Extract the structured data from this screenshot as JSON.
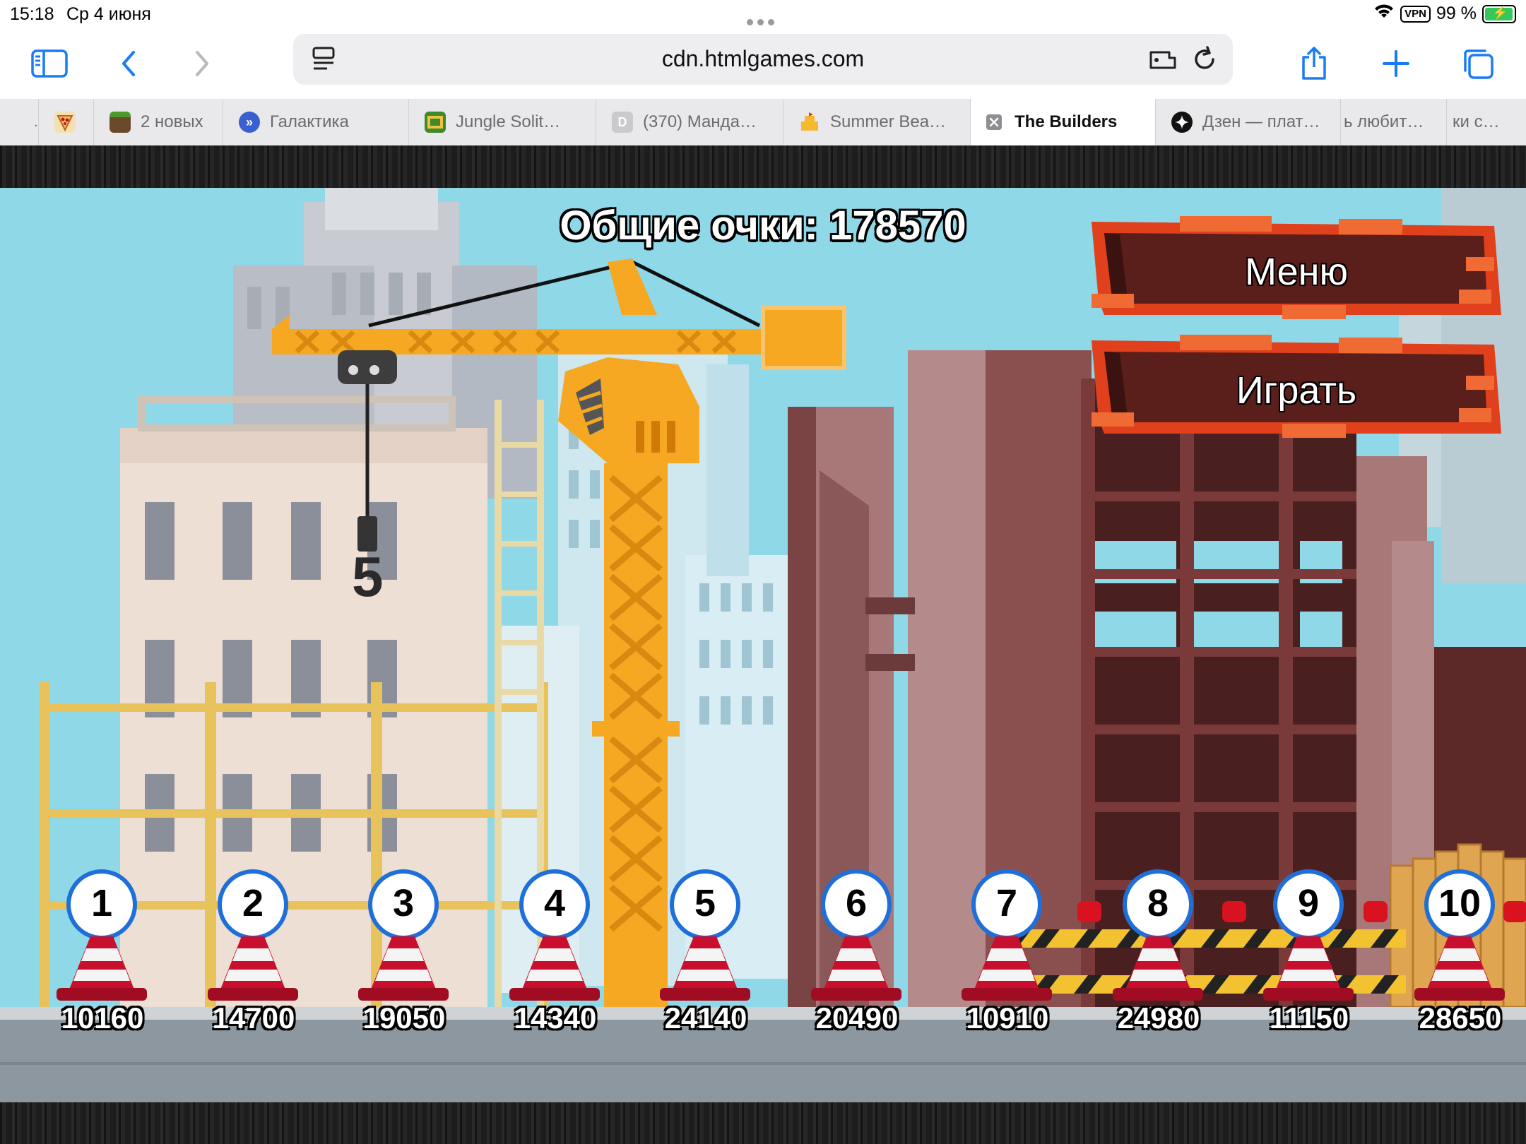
{
  "status": {
    "time": "15:18",
    "date": "Ср 4 июня",
    "vpn": "VPN",
    "battery": "99 %"
  },
  "browser": {
    "url": "cdn.htmlgames.com"
  },
  "tabs": [
    {
      "label": "",
      "icon": "pizza-favicon"
    },
    {
      "label": "2 новых",
      "icon": "minecraft-favicon"
    },
    {
      "label": "Галактика",
      "icon": "arrows-favicon"
    },
    {
      "label": "Jungle Solit…",
      "icon": "jungle-favicon"
    },
    {
      "label": "(370) Манда…",
      "icon": "letter-d-favicon"
    },
    {
      "label": "Summer Bea…",
      "icon": "sandcastle-favicon"
    },
    {
      "label": "The Builders",
      "icon": "close-icon"
    },
    {
      "label": "Дзен — плат…",
      "icon": "zen-favicon"
    },
    {
      "label": "ь любит…",
      "icon": ""
    },
    {
      "label": "ки с…",
      "icon": ""
    }
  ],
  "game": {
    "total_score_label": "Общие очки: 178570",
    "menu_button": "Меню",
    "play_button": "Играть",
    "hook_number": "5",
    "levels": [
      {
        "number": "1",
        "score": "10160"
      },
      {
        "number": "2",
        "score": "14700"
      },
      {
        "number": "3",
        "score": "19050"
      },
      {
        "number": "4",
        "score": "14340"
      },
      {
        "number": "5",
        "score": "24140"
      },
      {
        "number": "6",
        "score": "20490"
      },
      {
        "number": "7",
        "score": "10910"
      },
      {
        "number": "8",
        "score": "24980"
      },
      {
        "number": "9",
        "score": "11150"
      },
      {
        "number": "10",
        "score": "28650"
      }
    ],
    "colors": {
      "sky": "#8fd8e8",
      "crane": "#f7a823",
      "plank": "#5a1f1a",
      "plank_edge": "#e0401c",
      "cone": "#c8102e",
      "badge": "#1e6fd9"
    }
  }
}
